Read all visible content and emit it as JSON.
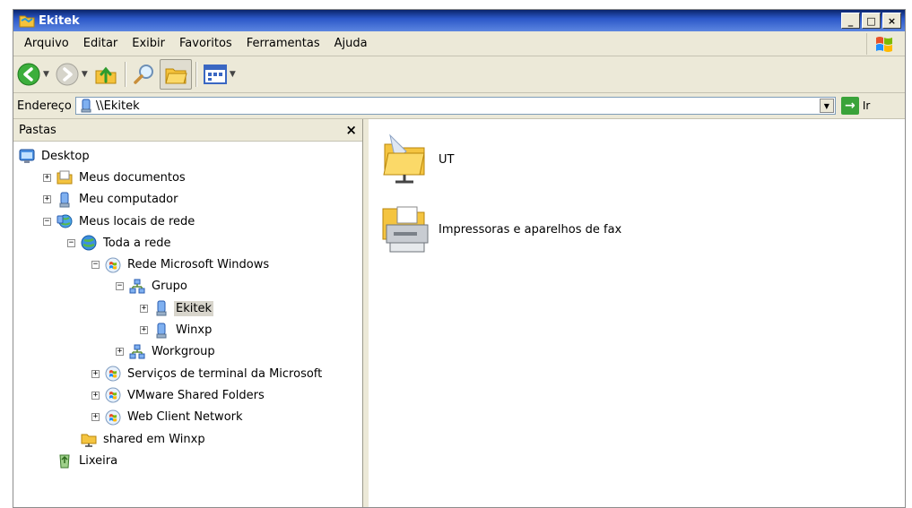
{
  "window": {
    "title": "Ekitek"
  },
  "menu": [
    "Arquivo",
    "Editar",
    "Exibir",
    "Favoritos",
    "Ferramentas",
    "Ajuda"
  ],
  "toolbar": {
    "back": "back-icon",
    "forward": "forward-icon",
    "up": "up-folder-icon",
    "search": "search-icon",
    "folders": "folders-icon",
    "views": "views-icon"
  },
  "address": {
    "label": "Endereço",
    "value": "\\\\Ekitek",
    "go_label": "Ir"
  },
  "folders_pane": {
    "title": "Pastas",
    "close": "×",
    "tree": [
      {
        "label": "Desktop",
        "level": 0,
        "expander": "",
        "icon": "desktop-icon"
      },
      {
        "label": "Meus documentos",
        "level": 1,
        "expander": "+",
        "icon": "my-documents-icon"
      },
      {
        "label": "Meu computador",
        "level": 1,
        "expander": "+",
        "icon": "my-computer-icon"
      },
      {
        "label": "Meus locais de rede",
        "level": 1,
        "expander": "−",
        "icon": "network-places-icon"
      },
      {
        "label": "Toda a rede",
        "level": 2,
        "expander": "−",
        "icon": "entire-network-icon"
      },
      {
        "label": "Rede Microsoft Windows",
        "level": 3,
        "expander": "−",
        "icon": "windows-network-icon"
      },
      {
        "label": "Grupo",
        "level": 4,
        "expander": "−",
        "icon": "workgroup-icon"
      },
      {
        "label": "Ekitek",
        "level": 5,
        "expander": "+",
        "icon": "computer-icon",
        "selected": true
      },
      {
        "label": "Winxp",
        "level": 5,
        "expander": "+",
        "icon": "computer-icon"
      },
      {
        "label": "Workgroup",
        "level": 4,
        "expander": "+",
        "icon": "workgroup-icon"
      },
      {
        "label": "Serviços de terminal da Microsoft",
        "level": 3,
        "expander": "+",
        "icon": "windows-network-icon"
      },
      {
        "label": "VMware Shared Folders",
        "level": 3,
        "expander": "+",
        "icon": "windows-network-icon"
      },
      {
        "label": "Web Client Network",
        "level": 3,
        "expander": "+",
        "icon": "windows-network-icon"
      },
      {
        "label": "shared em Winxp",
        "level": 2,
        "expander": "",
        "icon": "shared-folder-icon"
      },
      {
        "label": "Lixeira",
        "level": 1,
        "expander": "",
        "icon": "recycle-bin-icon"
      }
    ]
  },
  "main_items": [
    {
      "label": "UT",
      "icon": "shared-folder-icon"
    },
    {
      "label": "Impressoras e aparelhos de fax",
      "icon": "printers-fax-icon"
    }
  ]
}
